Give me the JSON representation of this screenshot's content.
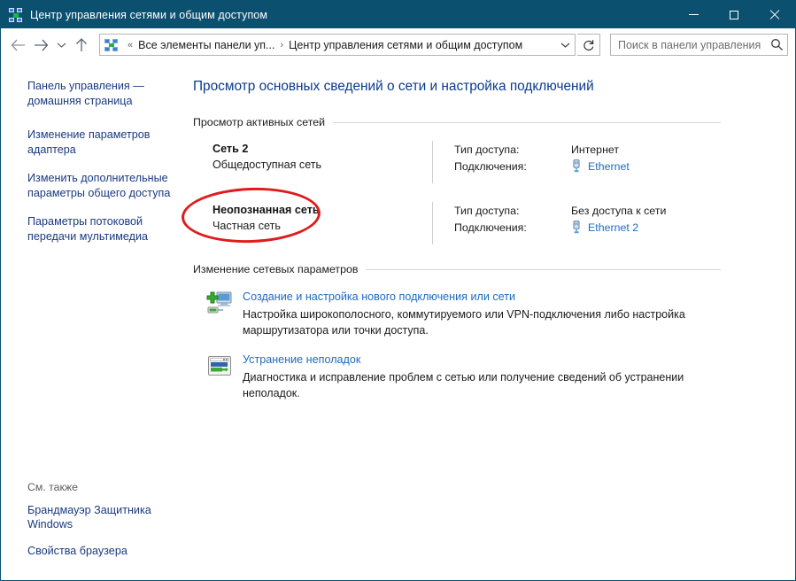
{
  "window": {
    "title": "Центр управления сетями и общим доступом",
    "icon": "network-sharing-icon",
    "accent_color": "#0c5070",
    "controls": {
      "minimize": "minimize-icon",
      "maximize": "maximize-icon",
      "close": "close-icon"
    }
  },
  "navbar": {
    "back": "back-arrow-icon",
    "forward": "forward-arrow-icon",
    "recent": "chevron-down-icon",
    "up": "up-arrow-icon",
    "address_icon": "network-sharing-icon",
    "breadcrumb_prefix": "«",
    "breadcrumb": [
      "Все элементы панели уп...",
      "Центр управления сетями и общим доступом"
    ],
    "breadcrumb_separator": "›",
    "address_dropdown": "chevron-down-icon",
    "refresh": "refresh-icon",
    "search": {
      "placeholder": "Поиск в панели управления",
      "value": "",
      "icon": "search-icon"
    }
  },
  "sidebar": {
    "links": [
      "Панель управления — домашняя страница",
      "Изменение параметров адаптера",
      "Изменить дополнительные параметры общего доступа",
      "Параметры потоковой передачи мультимедиа"
    ],
    "see_also": {
      "title": "См. также",
      "links": [
        "Брандмауэр Защитника Windows",
        "Свойства браузера"
      ]
    }
  },
  "main": {
    "page_title": "Просмотр основных сведений о сети и настройка подключений",
    "active_networks": {
      "heading": "Просмотр активных сетей",
      "labels": {
        "access_type": "Тип доступа:",
        "connections": "Подключения:"
      },
      "rows": [
        {
          "name": "Сеть 2",
          "kind": "Общедоступная сеть",
          "access_type": "Интернет",
          "connection": "Ethernet",
          "connection_icon": "ethernet-plug-icon",
          "annotated": false
        },
        {
          "name": "Неопознанная сеть",
          "kind": "Частная сеть",
          "access_type": "Без доступа к сети",
          "connection": "Ethernet 2",
          "connection_icon": "ethernet-plug-icon",
          "annotated": true
        }
      ]
    },
    "change_settings": {
      "heading": "Изменение сетевых параметров",
      "tasks": [
        {
          "icon": "new-connection-icon",
          "link": "Создание и настройка нового подключения или сети",
          "description": "Настройка широкополосного, коммутируемого или VPN-подключения либо настройка маршрутизатора или точки доступа."
        },
        {
          "icon": "troubleshoot-icon",
          "link": "Устранение неполадок",
          "description": "Диагностика и исправление проблем с сетью или получение сведений об устранении неполадок."
        }
      ]
    }
  },
  "annotation": {
    "shape": "ellipse",
    "color": "#e01b1b",
    "target": "Неопознанная сеть"
  }
}
